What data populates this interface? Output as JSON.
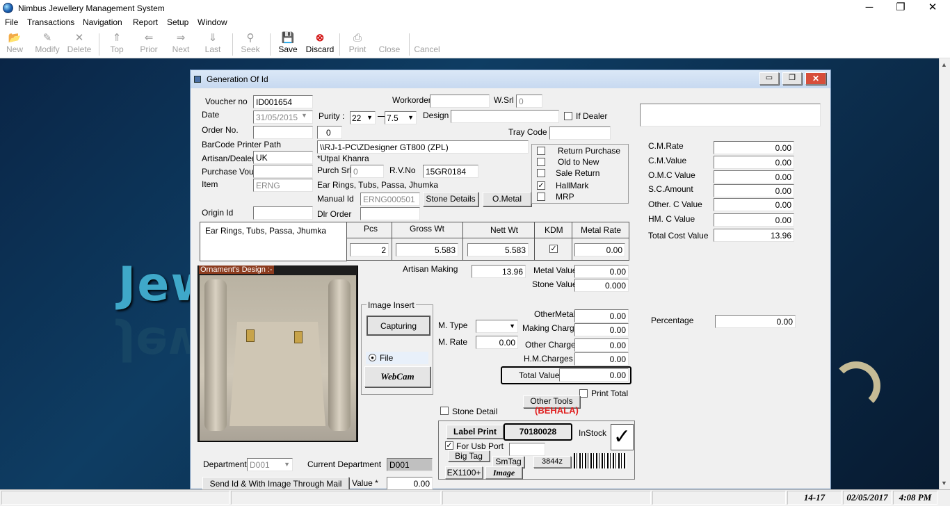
{
  "app": {
    "title": "Nimbus Jewellery Management System"
  },
  "window_controls": {
    "minimize": "─",
    "maximize": "❐",
    "close": "✕"
  },
  "menu": [
    "File",
    "Transactions",
    "Navigation",
    "Report",
    "Setup",
    "Window"
  ],
  "toolbar": [
    {
      "label": "New",
      "icon": "📂",
      "enabled": false
    },
    {
      "label": "Modify",
      "icon": "✎",
      "enabled": false
    },
    {
      "label": "Delete",
      "icon": "✕",
      "enabled": false
    },
    {
      "label": "Top",
      "icon": "⇑",
      "enabled": false
    },
    {
      "label": "Prior",
      "icon": "⇐",
      "enabled": false
    },
    {
      "label": "Next",
      "icon": "⇒",
      "enabled": false
    },
    {
      "label": "Last",
      "icon": "⇓",
      "enabled": false
    },
    {
      "label": "Seek",
      "icon": "⚲",
      "enabled": false
    },
    {
      "label": "Save",
      "icon": "💾",
      "enabled": true
    },
    {
      "label": "Discard",
      "icon": "⊗",
      "enabled": true
    },
    {
      "label": "Print",
      "icon": "⎙",
      "enabled": false
    },
    {
      "label": "Close",
      "icon": "",
      "enabled": false
    },
    {
      "label": "Cancel",
      "icon": "",
      "enabled": false
    }
  ],
  "background_text": "Jew",
  "dialog": {
    "title": "Generation Of Id",
    "voucher_no_label": "Voucher no",
    "voucher_no": "ID001654",
    "date_label": "Date",
    "date": "31/05/2015",
    "order_no_label": "Order No.",
    "order_no": "",
    "barcode_printer_label": "BarCode Printer Path",
    "artisan_label": "Artisan/Dealer",
    "artisan": "UK",
    "purchase_vou_label": "Purchase Vou",
    "purchase_vou": "",
    "item_label": "Item",
    "item": "ERNG",
    "origin_id_label": "Origin Id",
    "origin_id": "",
    "purity_label": "Purity :",
    "purity_1": "22",
    "purity_2": "7.5",
    "counter_value": "0",
    "printer_path": "\\\\RJ-1-PC\\ZDesigner GT800 (ZPL)",
    "artisan_name": "*Utpal Khanra",
    "purch_srl_label": "Purch Srl",
    "purch_srl": "0",
    "rv_no_label": "R.V.No",
    "rv_no": "15GR0184",
    "item_desc": "Ear Rings, Tubs, Passa, Jhumka",
    "manual_id_label": "Manual Id",
    "manual_id": "ERNG000501",
    "stone_details_btn": "Stone Details",
    "o_metal_btn": "O.Metal",
    "dlr_order_label": "Dlr Order",
    "dlr_order": "",
    "workorder_label": "Workorder",
    "workorder": "",
    "wsrl_label": "W.Srl",
    "wsrl": "0",
    "design_label": "Design",
    "design": "",
    "if_dealer_label": "If Dealer",
    "tray_code_label": "Tray Code",
    "tray_code": "",
    "options": [
      {
        "label": "Return Purchase",
        "checked": false
      },
      {
        "label": "Old to New",
        "checked": false
      },
      {
        "label": "Sale Return",
        "checked": false
      },
      {
        "label": "HallMark",
        "checked": true
      },
      {
        "label": "MRP",
        "checked": false
      }
    ],
    "memo_text": "Ear Rings, Tubs, Passa, Jhumka",
    "grid_headers": [
      "Pcs",
      "Gross Wt",
      "Nett Wt",
      "KDM",
      "Metal  Rate"
    ],
    "grid_values": {
      "pcs": "2",
      "gross_wt": "5.583",
      "nett_wt": "5.583",
      "kdm": true,
      "metal_rate": "0.00"
    },
    "ornament_label": "Ornament's Design :-",
    "artisan_making_label": "Artisan Making",
    "artisan_making": "13.96",
    "metal_value_label": "Metal Value",
    "metal_value": "0.00",
    "stone_value_label": "Stone Value",
    "stone_value": "0.000",
    "image_insert_label": "Image Insert",
    "capturing_btn": "Capturing",
    "file_label": "File",
    "webcam_btn": "WebCam",
    "m_type_label": "M. Type",
    "m_type": "",
    "m_rate_label": "M. Rate",
    "m_rate": "0.00",
    "other_metal_label": "OtherMetal",
    "other_metal": "0.00",
    "making_charge_label": "Making Charge",
    "making_charge": "0.00",
    "other_charges_label": "Other Charges",
    "other_charges": "0.00",
    "hm_charges_label": "H.M.Charges",
    "hm_charges": "0.00",
    "total_value_label": "Total Value",
    "total_value": "0.00",
    "print_total_label": "Print Total",
    "other_tools_btn": "Other Tools",
    "behala": "(BEHALA)",
    "stone_detail_label": "Stone Detail",
    "label_print_btn": "Label Print",
    "barcode_no": "70180028",
    "instock_label": "InStock",
    "instock_mark": "✓",
    "for_usb_label": "For Usb Port",
    "big_tag_btn": "Big Tag",
    "smtag_btn": "SmTag",
    "code_3844": "3844z",
    "ex1100_btn": "EX1100+",
    "image_btn": "Image",
    "department_label": "Department",
    "department": "D001",
    "current_dept_label": "Current Department",
    "current_dept": "D001",
    "send_btn": "Send Id & With Image Through Mail",
    "value_label": "Value *",
    "value": "0.00",
    "right_box": "",
    "cm_rate_label": "C.M.Rate",
    "cm_rate": "0.00",
    "cm_value_label": "C.M.Value",
    "cm_value": "0.00",
    "omc_value_label": "O.M.C Value",
    "omc_value": "0.00",
    "sc_amount_label": "S.C.Amount",
    "sc_amount": "0.00",
    "other_c_label": "Other. C Value",
    "other_c": "0.00",
    "hm_c_label": "HM. C Value",
    "hm_c": "0.00",
    "total_cost_label": "Total Cost Value",
    "total_cost": "13.96",
    "percentage_label": "Percentage",
    "percentage": "0.00"
  },
  "status": {
    "year": "14-17",
    "date": "02/05/2017",
    "time": "4:08 PM"
  }
}
